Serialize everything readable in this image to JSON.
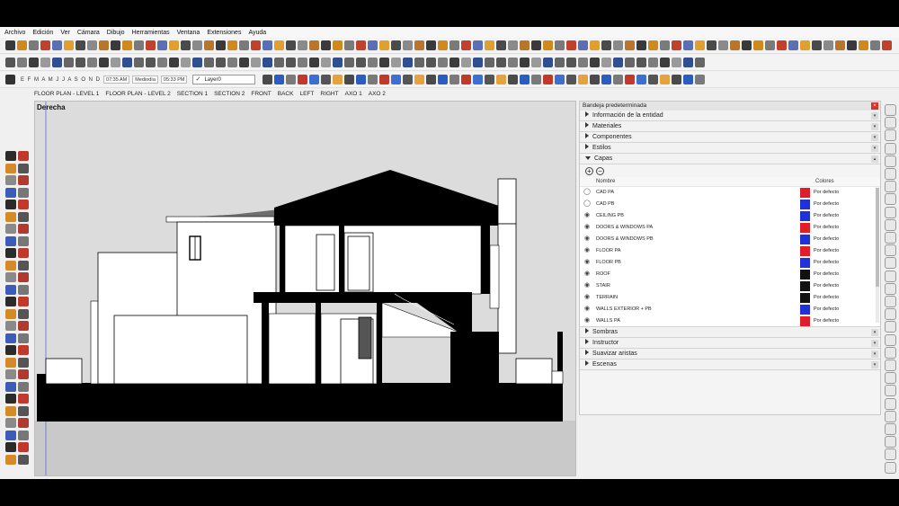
{
  "menu": [
    "Archivo",
    "Edición",
    "Ver",
    "Cámara",
    "Dibujo",
    "Herramientas",
    "Ventana",
    "Extensiones",
    "Ayuda"
  ],
  "shadow": {
    "months": "E F M A M J J A S O N D",
    "time_now": "07:35 AM",
    "midday": "Mediodía",
    "time_end": "05:33 PM"
  },
  "layer_select": {
    "value": "Layer0"
  },
  "scenes": [
    "FLOOR PLAN - LEVEL 1",
    "FLOOR PLAN - LEVEL 2",
    "SECTION 1",
    "SECTION 2",
    "FRONT",
    "BACK",
    "LEFT",
    "RIGHT",
    "AXO 1",
    "AXO 2"
  ],
  "viewport": {
    "label": "Derecha"
  },
  "tray": {
    "title": "Bandeja predeterminada",
    "panels_top": [
      "Información de la entidad",
      "Materiales",
      "Componentes",
      "Estilos"
    ],
    "layers_panel": "Capas",
    "layers_header": {
      "name": "Nombre",
      "color": "Colores"
    },
    "layers": [
      {
        "name": "CAD PA",
        "color": "#e01e2a",
        "label": "Por defecto",
        "visible": false
      },
      {
        "name": "CAD PB",
        "color": "#2230d8",
        "label": "Por defecto",
        "visible": false
      },
      {
        "name": "CEILING PB",
        "color": "#2230d8",
        "label": "Por defecto",
        "visible": true
      },
      {
        "name": "DOORS & WINDOWS PA",
        "color": "#e01e2a",
        "label": "Por defecto",
        "visible": true
      },
      {
        "name": "DOORS & WINDOWS PB",
        "color": "#2230d8",
        "label": "Por defecto",
        "visible": true
      },
      {
        "name": "FLOOR PA",
        "color": "#e01e2a",
        "label": "Por defecto",
        "visible": true
      },
      {
        "name": "FLOOR PB",
        "color": "#2230d8",
        "label": "Por defecto",
        "visible": true
      },
      {
        "name": "ROOF",
        "color": "#111111",
        "label": "Por defecto",
        "visible": true
      },
      {
        "name": "STAIR",
        "color": "#111111",
        "label": "Por defecto",
        "visible": true
      },
      {
        "name": "TERRAIN",
        "color": "#111111",
        "label": "Por defecto",
        "visible": true
      },
      {
        "name": "WALLS EXTERIOR + PB",
        "color": "#2230d8",
        "label": "Por defecto",
        "visible": true
      },
      {
        "name": "WALLS PA",
        "color": "#e01e2a",
        "label": "Por defecto",
        "visible": true
      }
    ],
    "panels_bottom": [
      "Sombras",
      "Instructor",
      "Suavizar aristas",
      "Escenas"
    ]
  }
}
